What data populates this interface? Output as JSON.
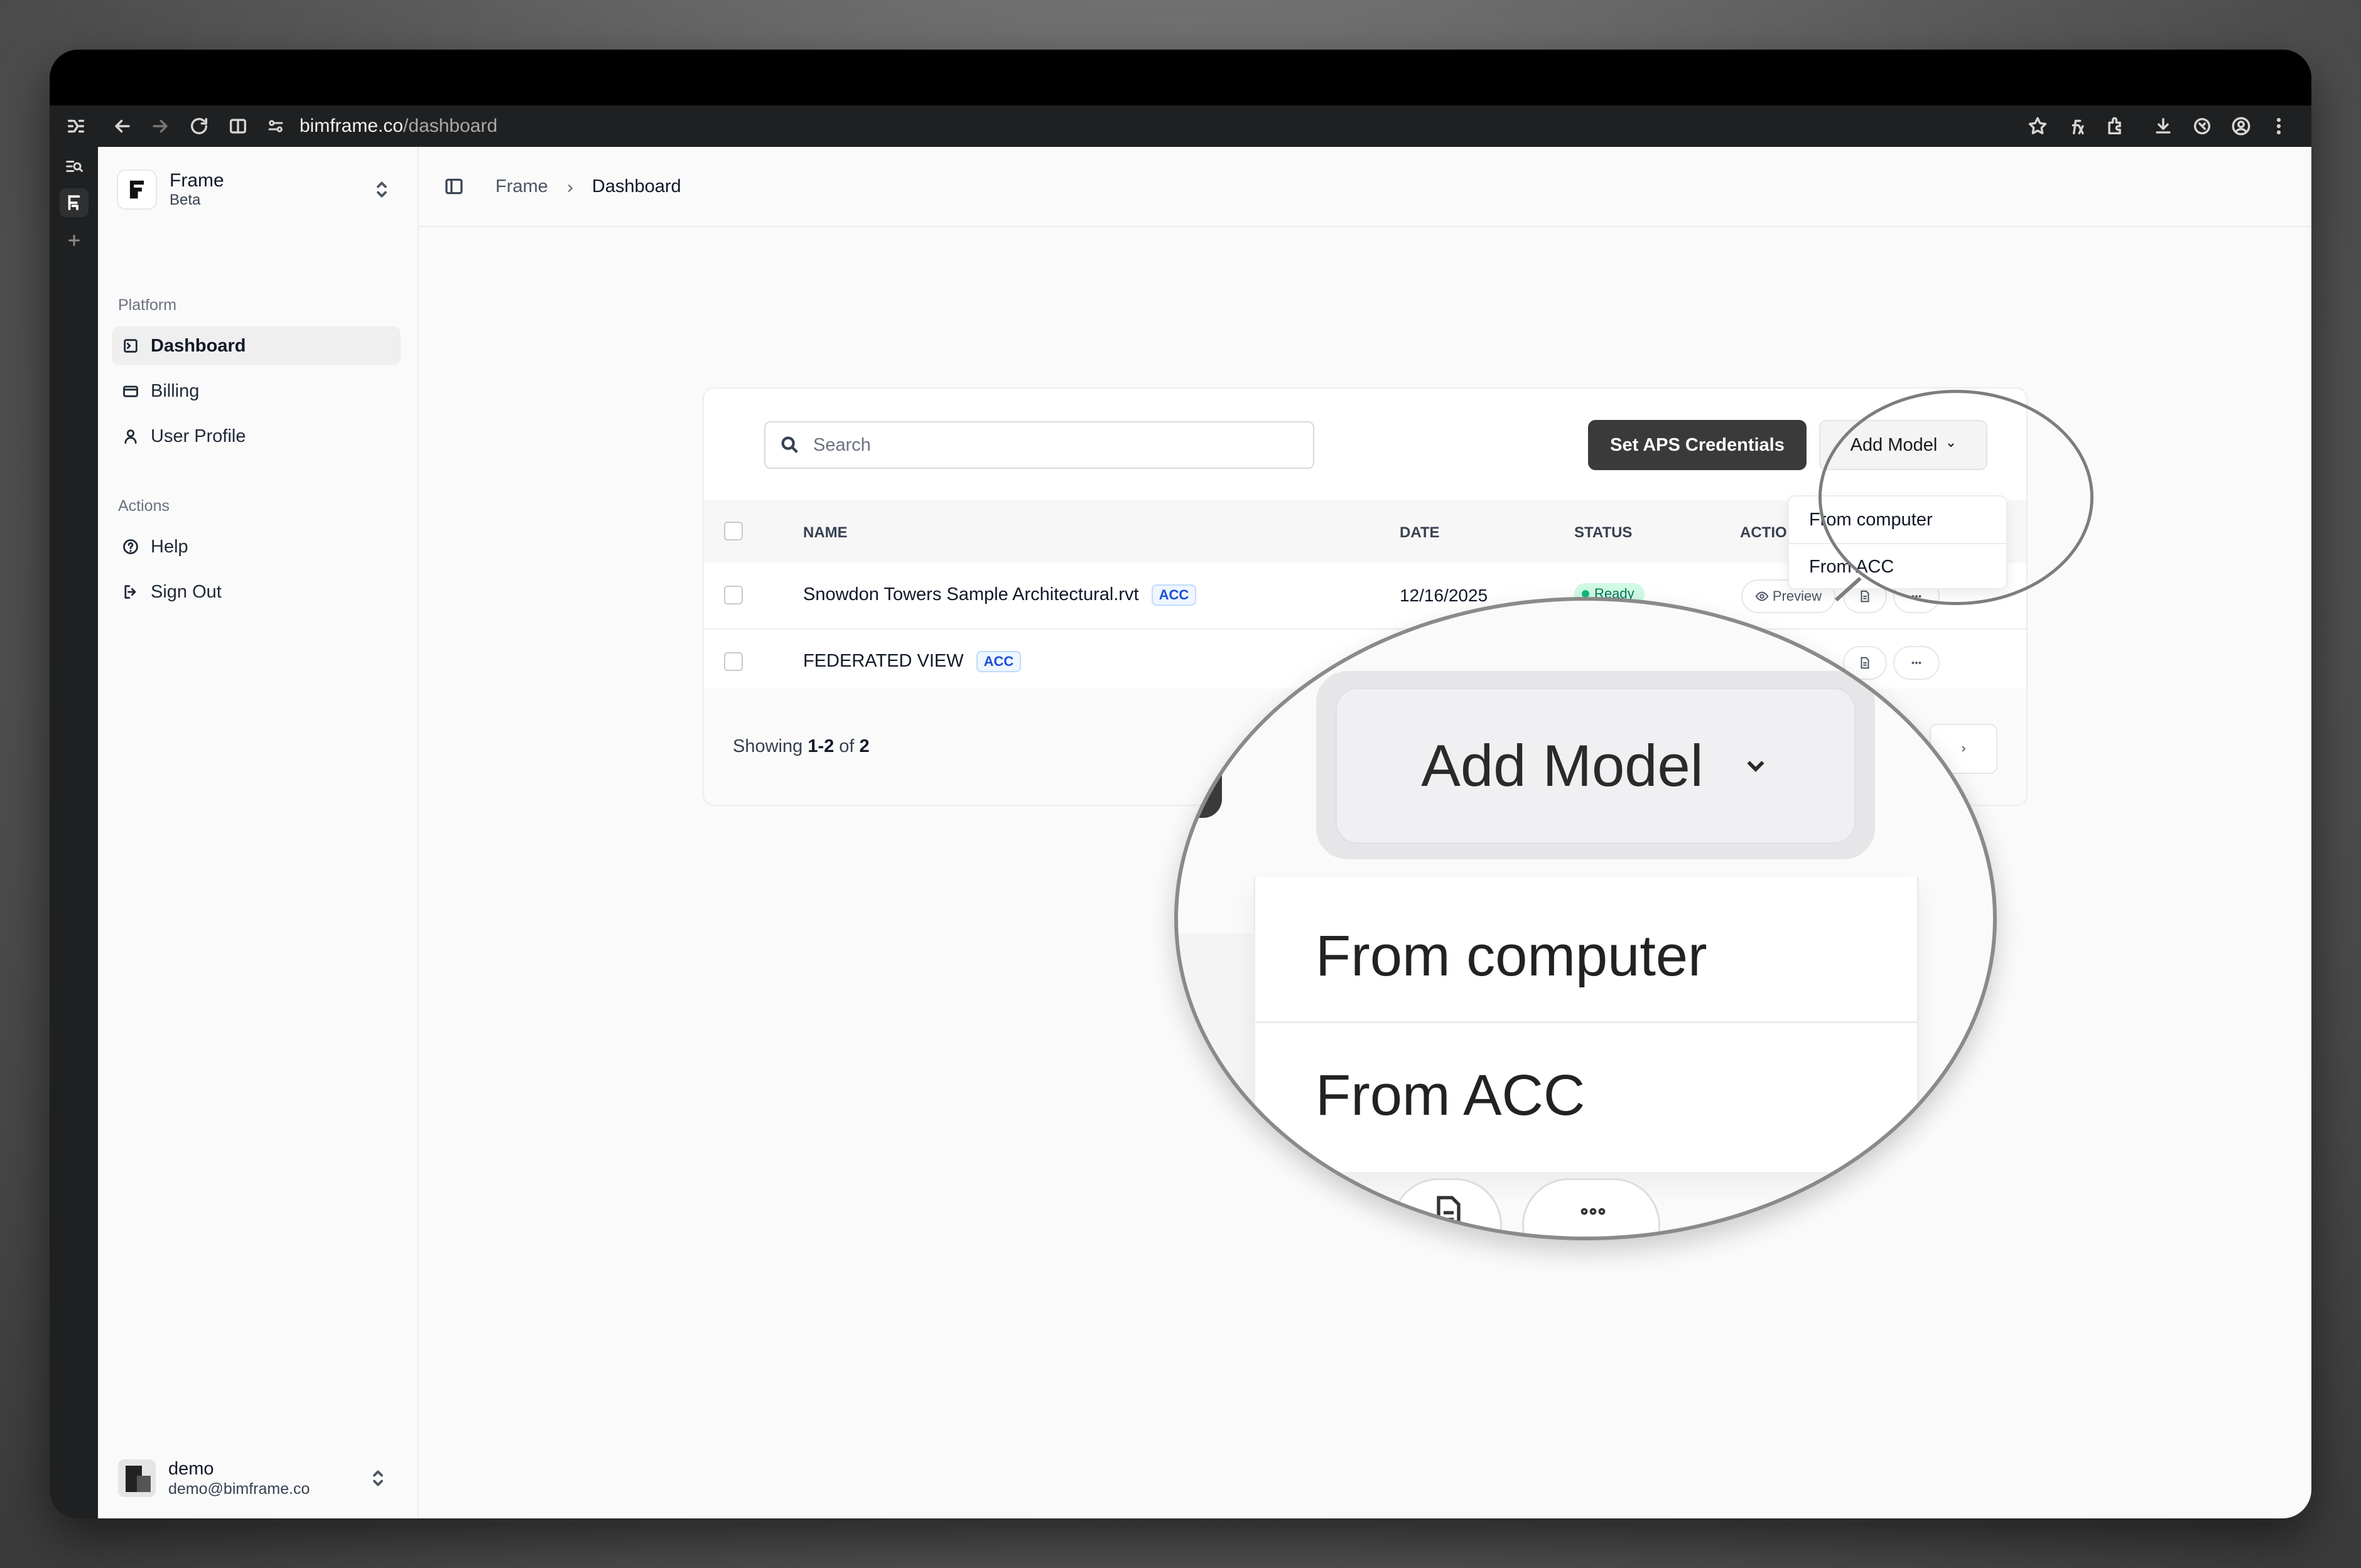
{
  "browser": {
    "url_host": "bimframe.co",
    "url_path": "/dashboard"
  },
  "sidebar": {
    "brand_name": "Frame",
    "brand_sub": "Beta",
    "platform_label": "Platform",
    "platform_items": [
      {
        "label": "Dashboard"
      },
      {
        "label": "Billing"
      },
      {
        "label": "User Profile"
      }
    ],
    "actions_label": "Actions",
    "action_items": [
      {
        "label": "Help"
      },
      {
        "label": "Sign Out"
      }
    ],
    "user": {
      "name": "demo",
      "email": "demo@bimframe.co"
    }
  },
  "breadcrumb": {
    "root": "Frame",
    "current": "Dashboard"
  },
  "toolbar": {
    "search_placeholder": "Search",
    "set_credentials_label": "Set APS Credentials",
    "add_model_label": "Add Model"
  },
  "dropdown": {
    "items": [
      {
        "label": "From computer"
      },
      {
        "label": "From ACC"
      }
    ]
  },
  "table": {
    "columns": [
      "NAME",
      "DATE",
      "STATUS",
      "ACTIONS"
    ],
    "rows": [
      {
        "name": "Snowdon Towers Sample Architectural.rvt",
        "source": "ACC",
        "date": "12/16/2025",
        "status": "Ready",
        "preview_label": "Preview"
      },
      {
        "name": "FEDERATED VIEW",
        "source": "ACC"
      }
    ]
  },
  "pagination": {
    "showing_prefix": "Showing",
    "range": "1-2",
    "of_label": "of",
    "total": "2"
  },
  "colors": {
    "primary_dark": "#3a3a3a",
    "badge_blue": "#1d4ed8",
    "status_green": "#10b981"
  }
}
